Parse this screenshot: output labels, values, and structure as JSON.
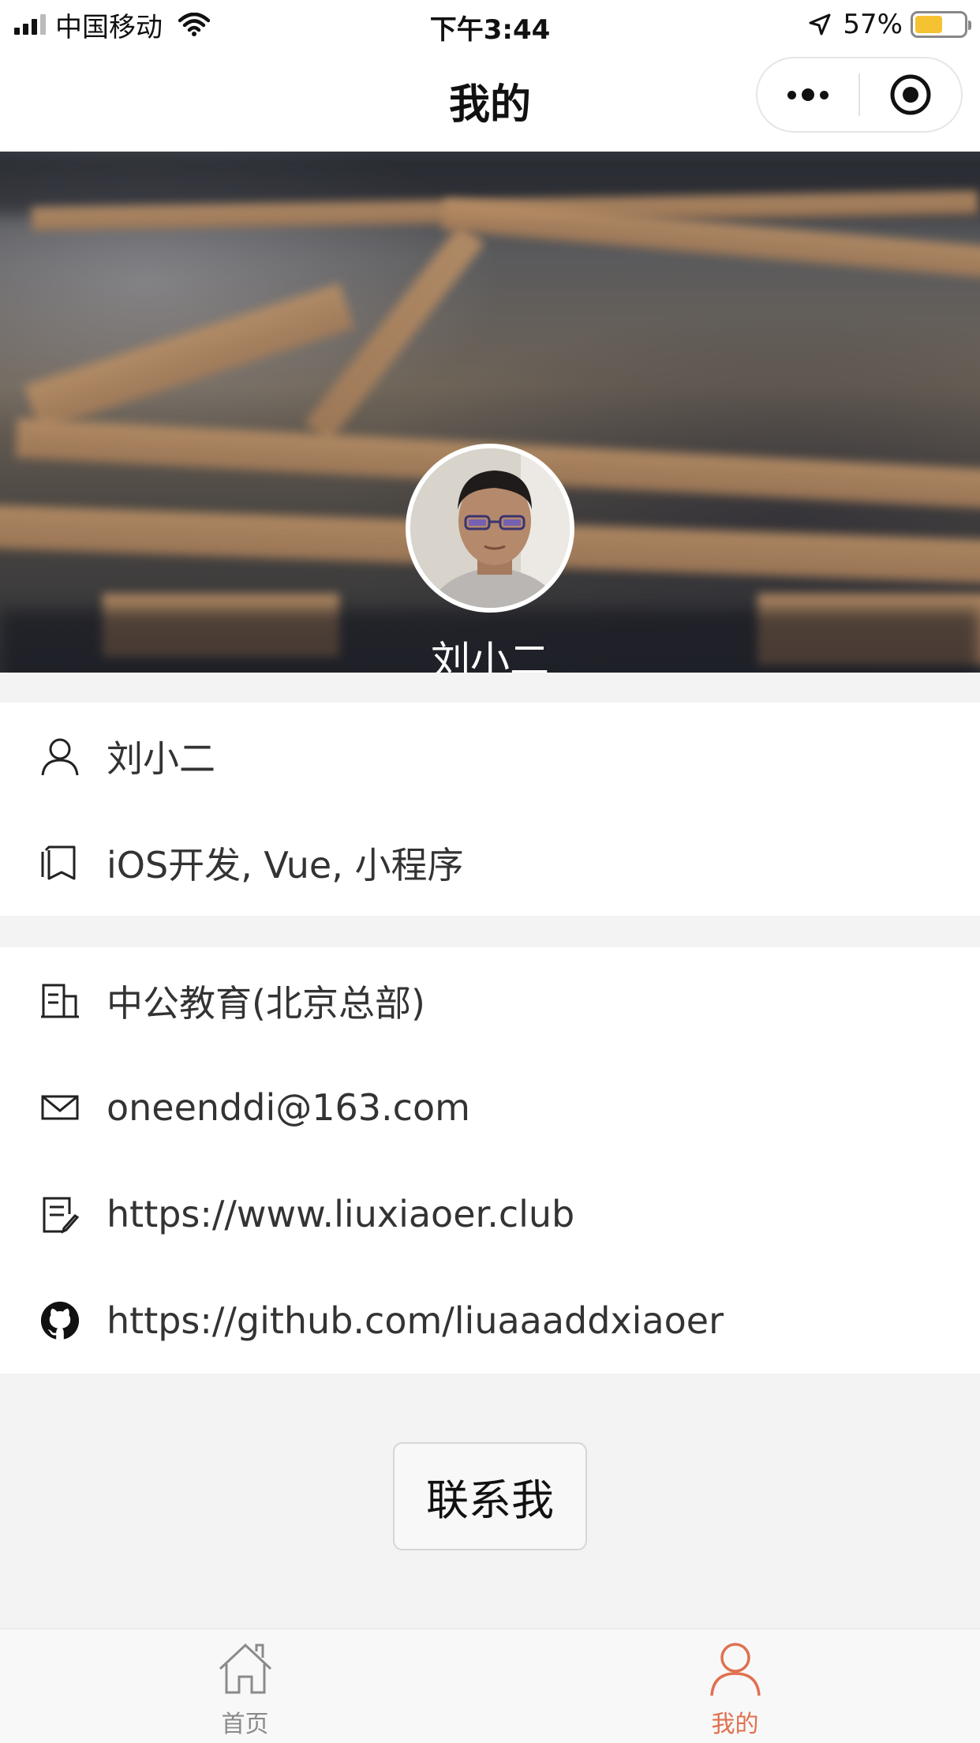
{
  "status_bar": {
    "carrier": "中国移动",
    "time": "下午3:44",
    "battery_percent": "57%",
    "battery_level": 0.57,
    "battery_color": "#f5c232"
  },
  "nav": {
    "title": "我的",
    "more_icon": "more-dots-icon",
    "close_icon": "target-close-icon"
  },
  "profile": {
    "name": "刘小二",
    "avatar_icon": "avatar-photo"
  },
  "info": {
    "basic": [
      {
        "icon": "user-icon",
        "text": "刘小二"
      },
      {
        "icon": "bookmark-icon",
        "text": "iOS开发, Vue, 小程序"
      }
    ],
    "contact": [
      {
        "icon": "building-icon",
        "text": "中公教育(北京总部)"
      },
      {
        "icon": "mail-icon",
        "text": "oneenddi@163.com"
      },
      {
        "icon": "edit-doc-icon",
        "text": "https://www.liuxiaoer.club"
      },
      {
        "icon": "github-icon",
        "text": "https://github.com/liuaaaddxiaoer"
      }
    ]
  },
  "contact_button": {
    "label": "联系我"
  },
  "tab_bar": {
    "tabs": [
      {
        "label": "首页",
        "icon": "home-icon",
        "active": false
      },
      {
        "label": "我的",
        "icon": "user-icon",
        "active": true
      }
    ],
    "active_color": "#e0704f",
    "inactive_color": "#8a8a8a"
  }
}
